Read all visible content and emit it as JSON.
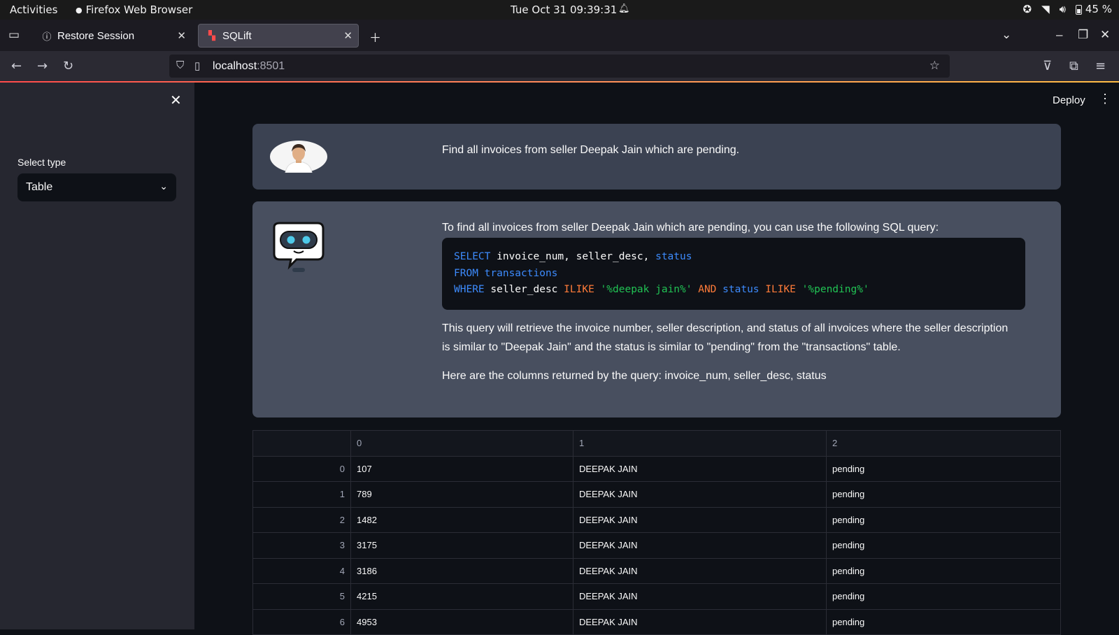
{
  "system_bar": {
    "activities": "Activities",
    "app_name": "Firefox Web Browser",
    "clock": "Tue Oct 31  09:39:31",
    "battery": "45 %"
  },
  "tabs": [
    {
      "title": "Restore Session",
      "active": false
    },
    {
      "title": "SQLift",
      "active": true
    }
  ],
  "url": {
    "host": "localhost",
    "port": ":8501"
  },
  "sidebar": {
    "select_label": "Select type",
    "select_value": "Table"
  },
  "header": {
    "deploy_label": "Deploy"
  },
  "chat": {
    "user_message": "Find all invoices from seller Deepak Jain which are pending.",
    "bot_intro": "To find all invoices from seller Deepak Jain which are pending, you can use the following SQL query:",
    "sql": {
      "line1": {
        "select": "SELECT",
        "cols": " invoice_num, seller_desc, ",
        "status": "status"
      },
      "line2": {
        "from": "FROM",
        "table": " transactions"
      },
      "line3": {
        "where": "WHERE",
        "col": " seller_desc ",
        "ilike1": "ILIKE",
        "str1": " '%deepak jain%' ",
        "and": "AND",
        "status": " status ",
        "ilike2": "ILIKE",
        "str2": " '%pending%'"
      }
    },
    "bot_explanation": "This query will retrieve the invoice number, seller description, and status of all invoices where the seller description is similar to \"Deepak Jain\" and the status is similar to \"pending\" from the \"transactions\" table.",
    "bot_columns": "Here are the columns returned by the query: invoice_num, seller_desc, status"
  },
  "table": {
    "columns": [
      "0",
      "1",
      "2"
    ],
    "rows": [
      {
        "index": "0",
        "c0": "107",
        "c1": "DEEPAK JAIN",
        "c2": "pending"
      },
      {
        "index": "1",
        "c0": "789",
        "c1": "DEEPAK JAIN",
        "c2": "pending"
      },
      {
        "index": "2",
        "c0": "1482",
        "c1": "DEEPAK JAIN",
        "c2": "pending"
      },
      {
        "index": "3",
        "c0": "3175",
        "c1": "DEEPAK JAIN",
        "c2": "pending"
      },
      {
        "index": "4",
        "c0": "3186",
        "c1": "DEEPAK JAIN",
        "c2": "pending"
      },
      {
        "index": "5",
        "c0": "4215",
        "c1": "DEEPAK JAIN",
        "c2": "pending"
      },
      {
        "index": "6",
        "c0": "4953",
        "c1": "DEEPAK JAIN",
        "c2": "pending"
      }
    ]
  },
  "colors": {
    "accent": "#ff4b4b",
    "keyword": "#3d8bfd",
    "operator": "#ff7b39",
    "string": "#21c354"
  }
}
